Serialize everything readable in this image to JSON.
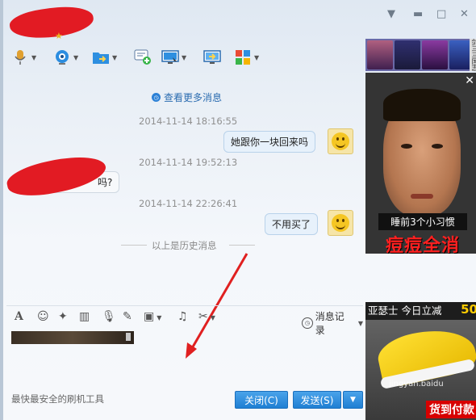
{
  "chat": {
    "more_messages": "查看更多消息",
    "messages": [
      {
        "timestamp": "2014-11-14 18:16:55",
        "text": "她跟你一块回来吗",
        "side": "right"
      },
      {
        "timestamp": "2014-11-14 19:52:13",
        "text": "吗?",
        "side": "left"
      },
      {
        "timestamp": "2014-11-14 22:26:41",
        "text": "不用买了",
        "side": "right"
      }
    ],
    "history_separator": "以上是历史消息"
  },
  "input_toolbar": {
    "history_label": "消息记录"
  },
  "footer": {
    "status_text": "最快最安全的刷机工具",
    "close_label": "关闭(C)",
    "send_label": "发送(S)"
  },
  "ads": {
    "top": {
      "subtitle": "睡前3个小习惯",
      "headline": "痘痘全消"
    },
    "bottom": {
      "headline": "亚瑟士 今日立减",
      "discount": "50",
      "button": "货到付款",
      "watermark": "jingyan.baidu"
    },
    "thumb_side_text": "剑三三国志"
  },
  "colors": {
    "accent_blue": "#1f7fd3",
    "bubble_bg": "#e7f1fb",
    "ad_red": "#ff2020"
  }
}
